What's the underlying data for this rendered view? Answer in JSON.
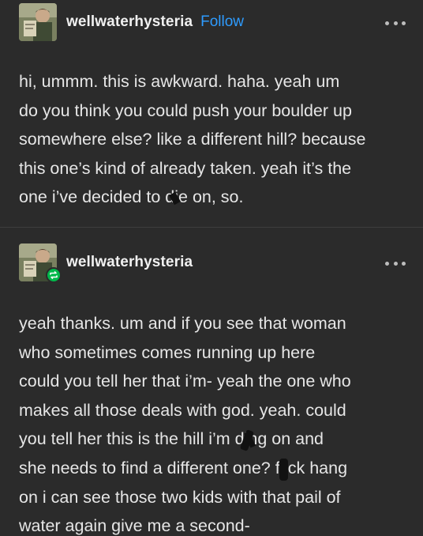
{
  "posts": [
    {
      "username": "wellwaterhysteria",
      "follow_label": "Follow",
      "lines": [
        "hi, ummm. this is awkward. haha. yeah um",
        "do you think you could push your boulder up",
        "somewhere else? like a different hill? because",
        "this one’s kind of already taken. yeah it’s the",
        "one i’ve decided to d",
        "ie on, so."
      ]
    },
    {
      "username": "wellwaterhysteria",
      "reblog": true,
      "lines": [
        "yeah thanks. um and if you see that woman",
        "who sometimes comes running up here",
        "could you tell her that i’m- yeah the one who",
        "makes all those deals with god. yeah. could",
        "you tell her this is the hill i’m d",
        "ing on and",
        "she needs to find a different one? f",
        "ck hang",
        "on i can see those two kids with that pail of",
        "water again give me a second-"
      ]
    }
  ],
  "colors": {
    "background": "#2b2b2b",
    "text": "#e6e6e6",
    "follow": "#2e9cff",
    "reblog_badge": "#00b84a"
  },
  "icons": {
    "more": "more-options-icon",
    "reblog": "reblog-icon"
  }
}
